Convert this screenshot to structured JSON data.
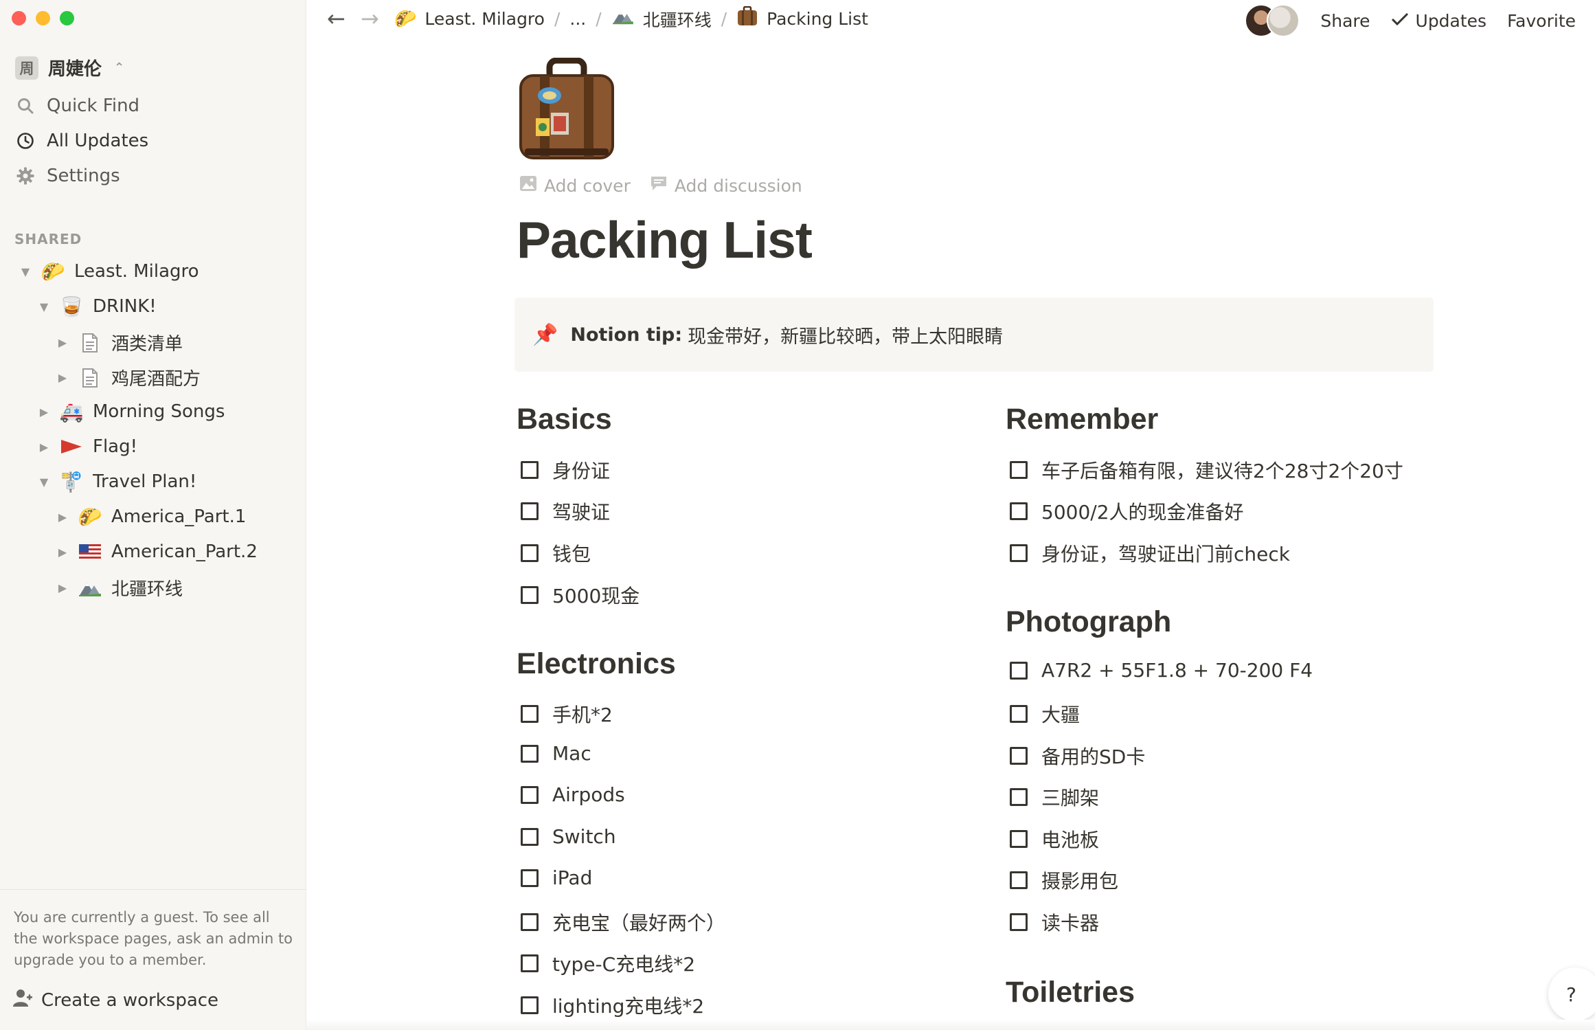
{
  "colors": {
    "close": "#fe5f57",
    "minimize": "#febc2e",
    "maximize": "#28c840",
    "sidebar_bg": "#f7f6f3",
    "text": "#37352f",
    "muted": "#9b9a97",
    "callout_bg": "#f7f6f3"
  },
  "sidebar": {
    "workspace": {
      "badge": "周",
      "name": "周婕伦"
    },
    "nav": [
      {
        "label": "Quick Find",
        "icon": "search-icon"
      },
      {
        "label": "All Updates",
        "icon": "clock-icon"
      },
      {
        "label": "Settings",
        "icon": "gear-icon"
      }
    ],
    "section_label": "SHARED",
    "tree": [
      {
        "label": "Least. Milagro",
        "emoji": "🌮",
        "icon": "taco-icon",
        "caret": "▼",
        "depth": 0
      },
      {
        "label": "DRINK!",
        "emoji": "🥃",
        "icon": "tumbler-glass-icon",
        "caret": "▼",
        "depth": 1
      },
      {
        "label": "酒类清单",
        "emoji": "📄",
        "icon": "page-icon",
        "caret": "▶",
        "depth": 2
      },
      {
        "label": "鸡尾酒配方",
        "emoji": "📄",
        "icon": "page-icon",
        "caret": "▶",
        "depth": 2
      },
      {
        "label": "Morning Songs",
        "emoji": "🚑",
        "icon": "ambulance-icon",
        "caret": "▶",
        "depth": 1
      },
      {
        "label": "Flag!",
        "emoji": "🚩",
        "icon": "flag-icon",
        "caret": "▶",
        "depth": 1
      },
      {
        "label": "Travel Plan!",
        "emoji": "🚏",
        "icon": "bus-stop-icon",
        "caret": "▼",
        "depth": 1
      },
      {
        "label": "America_Part.1",
        "emoji": "🌮",
        "icon": "taco-badge-icon",
        "caret": "▶",
        "depth": 2
      },
      {
        "label": "American_Part.2",
        "emoji": "🇺🇸",
        "icon": "us-flag-icon",
        "caret": "▶",
        "depth": 2
      },
      {
        "label": "北疆环线",
        "emoji": "⛰️",
        "icon": "mountain-icon",
        "caret": "▶",
        "depth": 2
      }
    ],
    "guest_note": "You are currently a guest. To see all the workspace pages, ask an admin to upgrade you to a member.",
    "create_workspace": "Create a workspace"
  },
  "topbar": {
    "back": "←",
    "forward": "→",
    "breadcrumb": [
      {
        "emoji": "🌮",
        "label": "Least. Milagro"
      },
      {
        "emoji": "",
        "label": "..."
      },
      {
        "emoji": "⛰️",
        "label": "北疆环线"
      },
      {
        "emoji": "💼",
        "label": "Packing List"
      }
    ],
    "share": "Share",
    "updates": "Updates",
    "favorite": "Favorite"
  },
  "page": {
    "add_cover": "Add cover",
    "add_discussion": "Add discussion",
    "title": "Packing List",
    "callout": {
      "emoji": "📌",
      "bold": "Notion tip:",
      "text": "现金带好，新疆比较晒，带上太阳眼睛"
    },
    "sections": {
      "basics": {
        "heading": "Basics",
        "items": [
          "身份证",
          "驾驶证",
          "钱包",
          "5000现金"
        ]
      },
      "electronics": {
        "heading": "Electronics",
        "items": [
          "手机*2",
          "Mac",
          "Airpods",
          "Switch",
          "iPad",
          "充电宝（最好两个）",
          "type-C充电线*2",
          "lighting充电线*2"
        ]
      },
      "remember": {
        "heading": "Remember",
        "items": [
          "车子后备箱有限，建议待2个28寸2个20寸",
          "5000/2人的现金准备好",
          "身份证，驾驶证出门前check"
        ]
      },
      "photograph": {
        "heading": "Photograph",
        "items": [
          "A7R2 + 55F1.8 + 70-200 F4",
          "大疆",
          "备用的SD卡",
          "三脚架",
          "电池板",
          "摄影用包",
          "读卡器"
        ]
      },
      "toiletries": {
        "heading": "Toiletries"
      }
    },
    "help": "?"
  }
}
